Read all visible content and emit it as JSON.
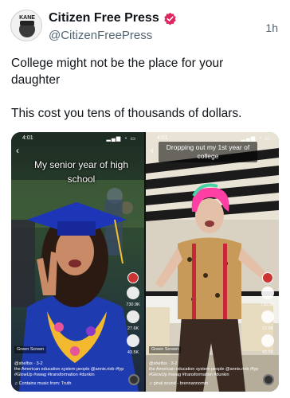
{
  "account": {
    "display_name": "Citizen Free Press",
    "handle": "@CitizenFreePress",
    "avatar_text": "KANE",
    "time": "1h"
  },
  "tweet": {
    "line1": "College might not be the place for your daughter",
    "line2": "This cost you tens of thousands of dollars."
  },
  "media": {
    "left": {
      "clock": "4:01",
      "caption": "My senior year of high school",
      "like_count": "730.9K",
      "comment_count": "27.6K",
      "share_count": "43.5K",
      "green_screen": "Green Screen",
      "user": "@shelfss · 3-2",
      "desc": "the American education system people @annis.rieb #fyp #GlowUp #swag #transformation #dunkin",
      "music": "Contains music from: Truth"
    },
    "right": {
      "clock": "4:01",
      "caption": "Dropping out my 1st year of college",
      "like_count": "730.9K",
      "comment_count": "27.6K",
      "share_count": "43.5K",
      "green_screen": "Green Screen",
      "user": "@shelfss · 3-2",
      "desc": "the American education system people @annis.rieb #fyp #GlowUp #swag #transformation #dunkin",
      "music": "ginal sound - brennannomm"
    }
  },
  "colors": {
    "verified": "#e0245e",
    "gown": "#1f3bb0",
    "hair_pink": "#ff3fa4"
  }
}
